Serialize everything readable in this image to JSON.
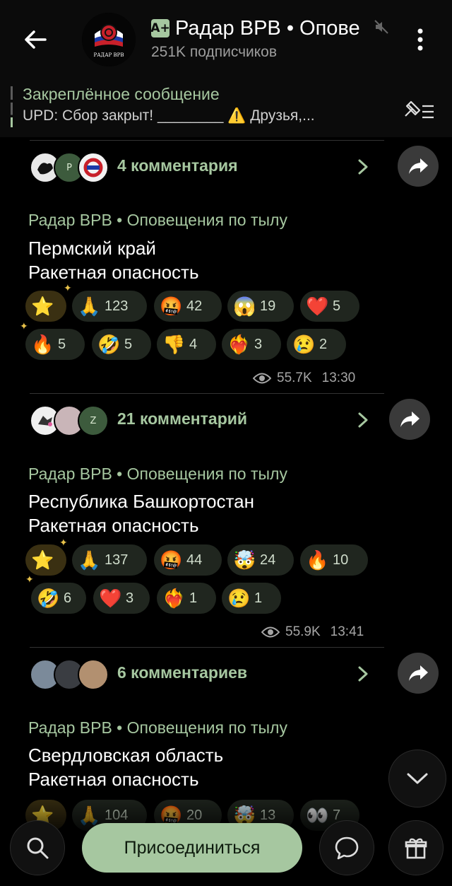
{
  "header": {
    "title": "Радар ВРВ • Опове",
    "badge": "A+",
    "subscribers": "251K подписчиков",
    "avatar_text": "РАДАР ВРВ"
  },
  "pinned": {
    "title": "Закреплённое сообщение",
    "text": "UPD: Сбор закрыт! ________ ⚠️ Друзья,..."
  },
  "posts": [
    {
      "comments": "4 комментария",
      "avatar_letters": [
        "",
        "P",
        ""
      ],
      "source": "Радар ВРВ • Оповещения по тылу",
      "line1": "Пермский край",
      "line2": "Ракетная опасность",
      "reactions": [
        {
          "emoji": "⭐",
          "count": ""
        },
        {
          "emoji": "🙏",
          "count": "123"
        },
        {
          "emoji": "🤬",
          "count": "42"
        },
        {
          "emoji": "😱",
          "count": "19"
        },
        {
          "emoji": "❤️",
          "count": "5"
        },
        {
          "emoji": "🔥",
          "count": "5"
        },
        {
          "emoji": "🤣",
          "count": "5"
        },
        {
          "emoji": "👎",
          "count": "4"
        },
        {
          "emoji": "❤️‍🔥",
          "count": "3"
        },
        {
          "emoji": "😢",
          "count": "2"
        }
      ],
      "views": "55.7K",
      "time": "13:30"
    },
    {
      "comments": "21 комментарий",
      "avatar_letters": [
        "",
        "",
        "Z"
      ],
      "source": "Радар ВРВ • Оповещения по тылу",
      "line1": "Республика Башкортостан",
      "line2": "Ракетная опасность",
      "reactions": [
        {
          "emoji": "⭐",
          "count": ""
        },
        {
          "emoji": "🙏",
          "count": "137"
        },
        {
          "emoji": "🤬",
          "count": "44"
        },
        {
          "emoji": "🤯",
          "count": "24"
        },
        {
          "emoji": "🔥",
          "count": "10"
        },
        {
          "emoji": "🤣",
          "count": "6"
        },
        {
          "emoji": "❤️",
          "count": "3"
        },
        {
          "emoji": "❤️‍🔥",
          "count": "1"
        },
        {
          "emoji": "😢",
          "count": "1"
        }
      ],
      "views": "55.9K",
      "time": "13:41"
    },
    {
      "comments": "6 комментариев",
      "avatar_letters": [
        "",
        "",
        ""
      ],
      "source": "Радар ВРВ • Оповещения по тылу",
      "line1": "Свердловская область",
      "line2": "Ракетная опасность",
      "reactions": [
        {
          "emoji": "⭐",
          "count": ""
        },
        {
          "emoji": "🙏",
          "count": "104"
        },
        {
          "emoji": "🤬",
          "count": "20"
        },
        {
          "emoji": "🤯",
          "count": "13"
        },
        {
          "emoji": "👀",
          "count": "7"
        }
      ]
    }
  ],
  "bottom": {
    "join_label": "Присоединиться"
  },
  "colors": {
    "accent": "#a6c7a0",
    "chip_bg": "#20261f",
    "background": "#000000"
  },
  "icons": [
    "back-arrow-icon",
    "mute-icon",
    "kebab-menu-icon",
    "pin-list-icon",
    "chevron-right-icon",
    "share-icon",
    "eye-icon",
    "chevron-down-icon",
    "search-icon",
    "comment-icon",
    "gift-icon"
  ]
}
